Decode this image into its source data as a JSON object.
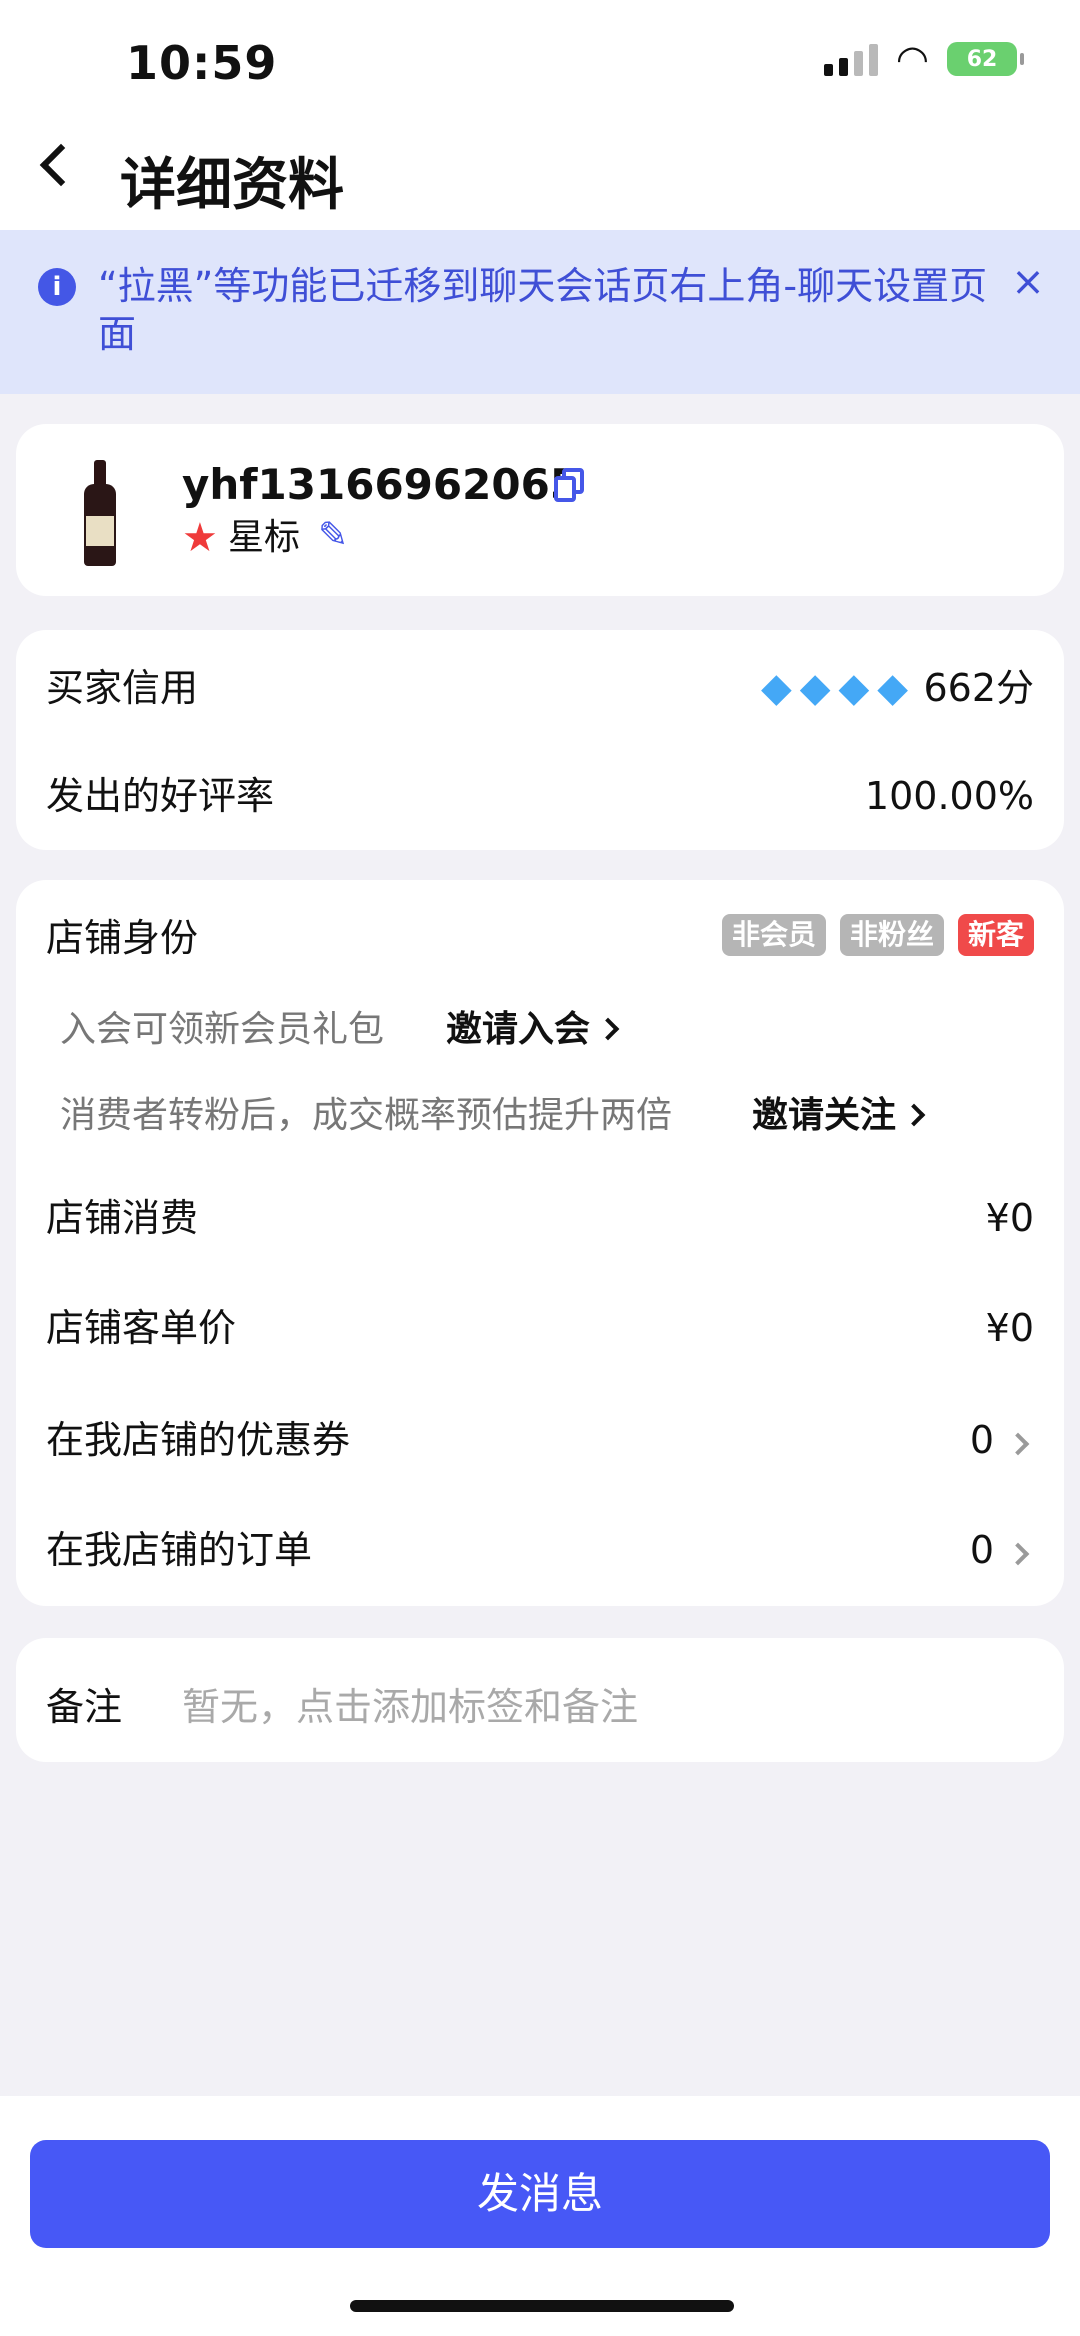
{
  "status_bar": {
    "time": "10:59",
    "battery": "62"
  },
  "header": {
    "title": "详细资料"
  },
  "notice": {
    "text": "“拉黑”等功能已迁移到聊天会话页右上角-聊天设置页面"
  },
  "profile": {
    "username": "yhf13166962065",
    "star_label": "星标"
  },
  "credit": {
    "buyer_credit_label": "买家信用",
    "buyer_credit_value": "662分",
    "diamond_count": 4,
    "good_rate_label": "发出的好评率",
    "good_rate_value": "100.00%"
  },
  "shop": {
    "identity_label": "店铺身份",
    "tags": [
      "非会员",
      "非粉丝",
      "新客"
    ],
    "invite_member_desc": "入会可领新会员礼包",
    "invite_member_link": "邀请入会",
    "invite_follow_desc": "消费者转粉后，成交概率预估提升两倍",
    "invite_follow_link": "邀请关注",
    "consumption_label": "店铺消费",
    "consumption_value": "¥0",
    "unit_price_label": "店铺客单价",
    "unit_price_value": "¥0",
    "coupons_label": "在我店铺的优惠券",
    "coupons_value": "0",
    "orders_label": "在我店铺的订单",
    "orders_value": "0"
  },
  "remark": {
    "label": "备注",
    "placeholder": "暂无，点击添加标签和备注"
  },
  "footer": {
    "send_button": "发消息"
  },
  "colors": {
    "accent": "#4758f6",
    "notice_bg": "#dfe5fb",
    "new_tag": "#f04a4a"
  }
}
